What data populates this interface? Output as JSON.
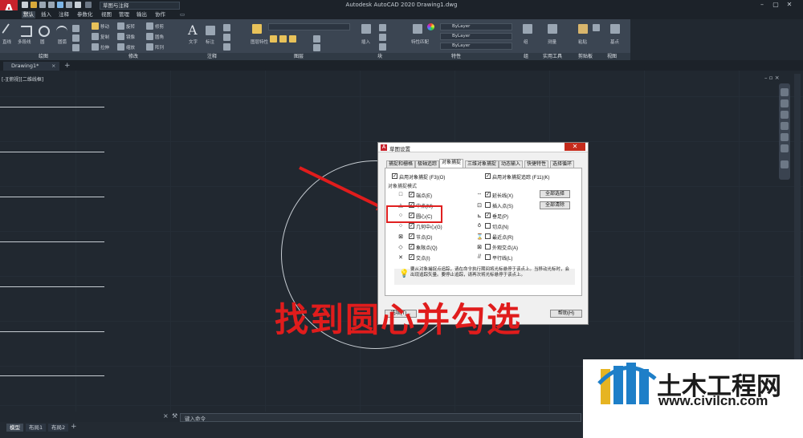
{
  "app": {
    "logo_letter": "A",
    "title": "Autodesk AutoCAD 2020    Drawing1.dwg",
    "workspace": "草图与注释"
  },
  "menu": {
    "items": [
      "默认",
      "插入",
      "注释",
      "参数化",
      "视图",
      "管理",
      "输出",
      "协作"
    ],
    "active_index": 0
  },
  "ribbon": {
    "panel_titles": [
      "绘图",
      "修改",
      "注释",
      "图层",
      "块",
      "特性",
      "组",
      "实用工具",
      "剪贴板",
      "视图"
    ],
    "by_layer_labels": [
      "ByLayer",
      "ByLayer",
      "ByLayer"
    ],
    "small_labels": [
      "直线",
      "多段线",
      "圆",
      "圆弧",
      "移动",
      "旋转",
      "修剪",
      "复制",
      "镜像",
      "圆角",
      "拉伸",
      "缩放",
      "阵列",
      "文字",
      "标注",
      "图层特性",
      "插入",
      "特性匹配",
      "组",
      "测量",
      "粘贴",
      "基点"
    ]
  },
  "doc_tab": {
    "label": "Drawing1*"
  },
  "viewport_label": "[-][俯视][二维线框]",
  "dialog": {
    "title": "草图设置",
    "close_glyph": "✕",
    "tabs": [
      "捕捉和栅格",
      "极轴追踪",
      "对象捕捉",
      "三维对象捕捉",
      "动态输入",
      "快捷特性",
      "选择循环"
    ],
    "active_tab_index": 2,
    "enable_osnap": "启用对象捕捉 (F3)(O)",
    "enable_tracking": "启用对象捕捉追踪 (F11)(K)",
    "group_label": "对象捕捉模式",
    "left_modes": [
      {
        "symbol": "□",
        "label": "端点(E)",
        "checked": true
      },
      {
        "symbol": "△",
        "label": "中点(M)",
        "checked": true
      },
      {
        "symbol": "○",
        "label": "圆心(C)",
        "checked": true
      },
      {
        "symbol": "○",
        "label": "几何中心(G)",
        "checked": true
      },
      {
        "symbol": "⊠",
        "label": "节点(D)",
        "checked": true
      },
      {
        "symbol": "◇",
        "label": "象限点(Q)",
        "checked": true
      },
      {
        "symbol": "✕",
        "label": "交点(I)",
        "checked": true
      }
    ],
    "right_modes": [
      {
        "symbol": "--",
        "label": "延长线(X)",
        "checked": true
      },
      {
        "symbol": "⊡",
        "label": "插入点(S)",
        "checked": false
      },
      {
        "symbol": "⊾",
        "label": "垂足(P)",
        "checked": true
      },
      {
        "symbol": "ō",
        "label": "切点(N)",
        "checked": false
      },
      {
        "symbol": "⌛",
        "label": "最近点(R)",
        "checked": false
      },
      {
        "symbol": "⊠",
        "label": "外观交点(A)",
        "checked": false
      },
      {
        "symbol": "//",
        "label": "平行线(L)",
        "checked": false
      }
    ],
    "select_all": "全部选择",
    "clear_all": "全部清除",
    "hint": "要从对象捕捉点追踪，请在命令执行期间将光标悬停于该点上。当移动光标时，会出现追踪矢量。要停止追踪，请再次将光标悬停于该点上。",
    "options_button": "选项(T)...",
    "help_button": "帮助(H)"
  },
  "annotation": {
    "big_text": "找到圆心并勾选",
    "arrow_color": "#e01c1c"
  },
  "command_line": {
    "prompt": "键入命令",
    "icons": [
      "close-icon",
      "wrench-icon"
    ]
  },
  "layout_tabs": {
    "items": [
      "模型",
      "布局1",
      "布局2"
    ],
    "active_index": 0
  },
  "watermark": {
    "name": "土木工程网",
    "url": "www.civilcn.com"
  },
  "colors": {
    "canvas": "#212830",
    "ribbon": "#3b4552",
    "accent_red": "#c8222c"
  }
}
